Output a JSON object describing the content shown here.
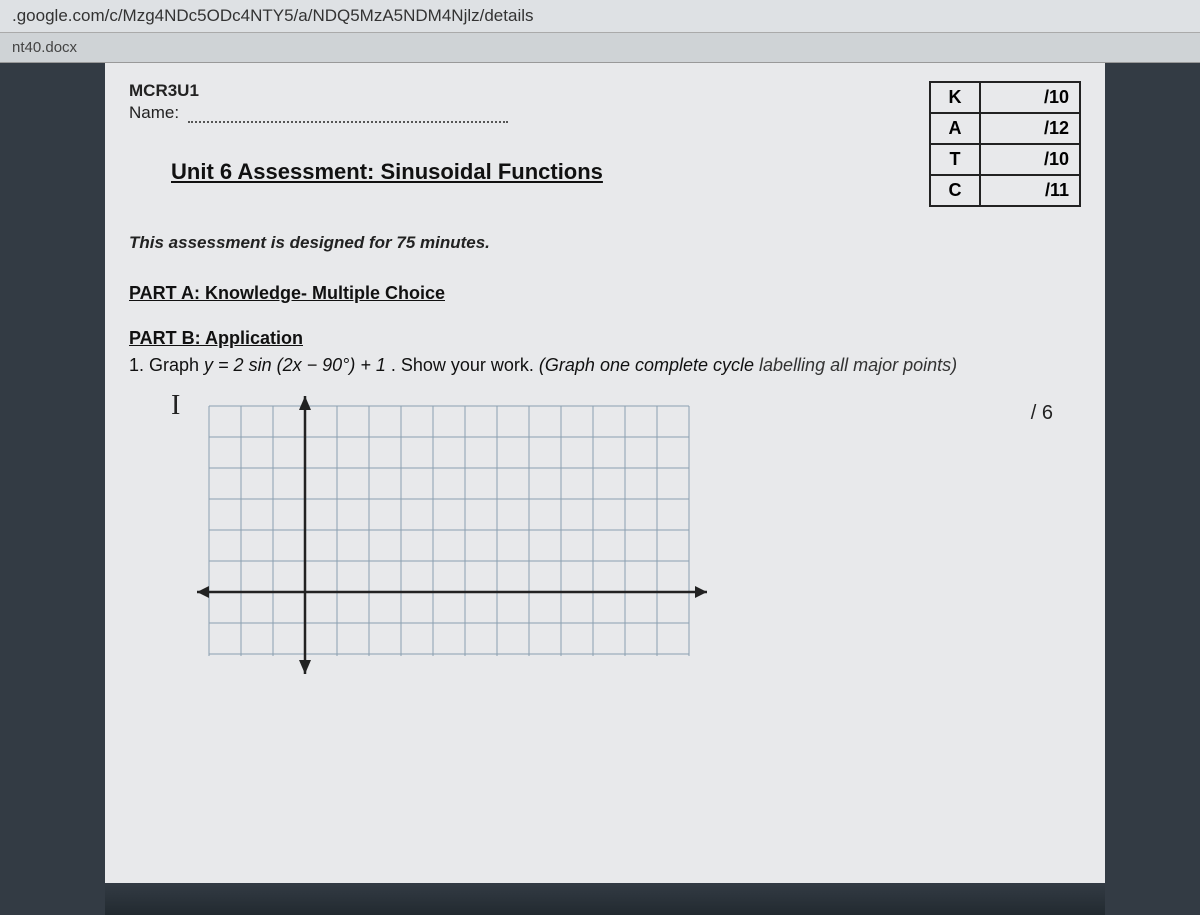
{
  "browser": {
    "url_fragment": ".google.com/c/Mzg4NDc5ODc4NTY5/a/NDQ5MzA5NDM4Njlz/details",
    "tab_label": "nt40.docx"
  },
  "document": {
    "course_code": "MCR3U1",
    "name_label": "Name:",
    "title": "Unit 6 Assessment:  Sinusoidal Functions",
    "rubric": [
      {
        "cat": "K",
        "score": "/10"
      },
      {
        "cat": "A",
        "score": "/12"
      },
      {
        "cat": "T",
        "score": "/10"
      },
      {
        "cat": "C",
        "score": "/11"
      }
    ],
    "duration": "This assessment is designed for 75 minutes.",
    "part_a": "PART A:  Knowledge- Multiple Choice",
    "part_b": "PART B:  Application",
    "q1_number": "1.  ",
    "q1_label": "Graph  ",
    "q1_equation": "y = 2 sin (2x − 90°) + 1",
    "q1_instruction": ".  Show your work. ",
    "q1_emph": "(Graph one complete cycle ",
    "q1_ital": "labelling all major points)",
    "q1_score": "/ 6"
  }
}
